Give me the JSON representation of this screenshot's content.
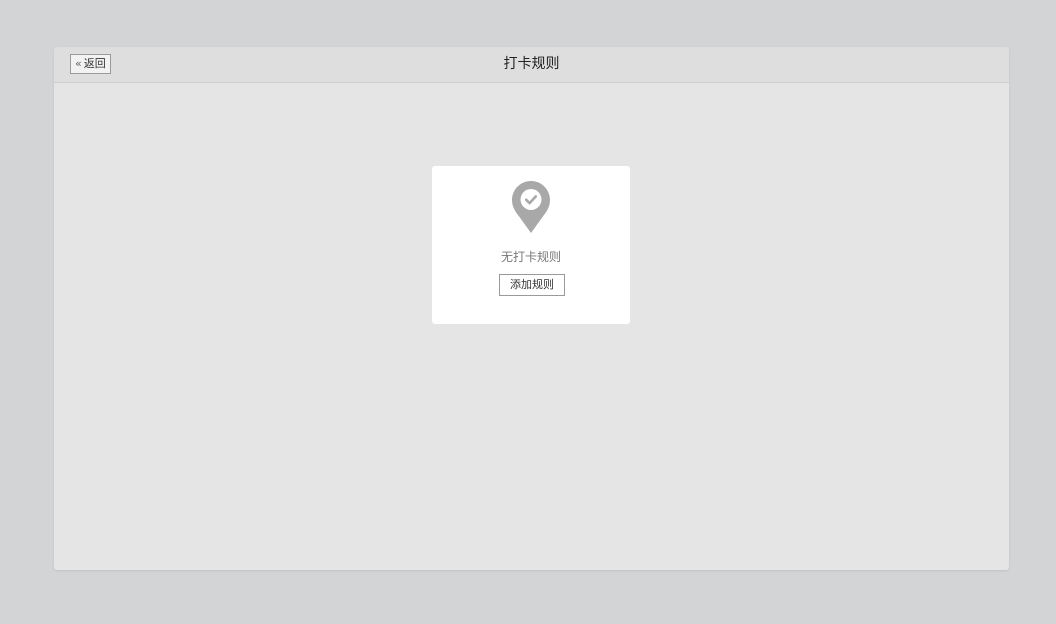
{
  "header": {
    "back_label": "返回",
    "title": "打卡规则"
  },
  "empty_state": {
    "icon": "location-check-icon",
    "message": "无打卡规则",
    "add_label": "添加规则"
  },
  "colors": {
    "page_bg": "#d3d4d6",
    "panel_bg": "#e5e5e5",
    "header_bg": "#dedede",
    "card_bg": "#ffffff",
    "icon_gray": "#a8a8a8"
  }
}
